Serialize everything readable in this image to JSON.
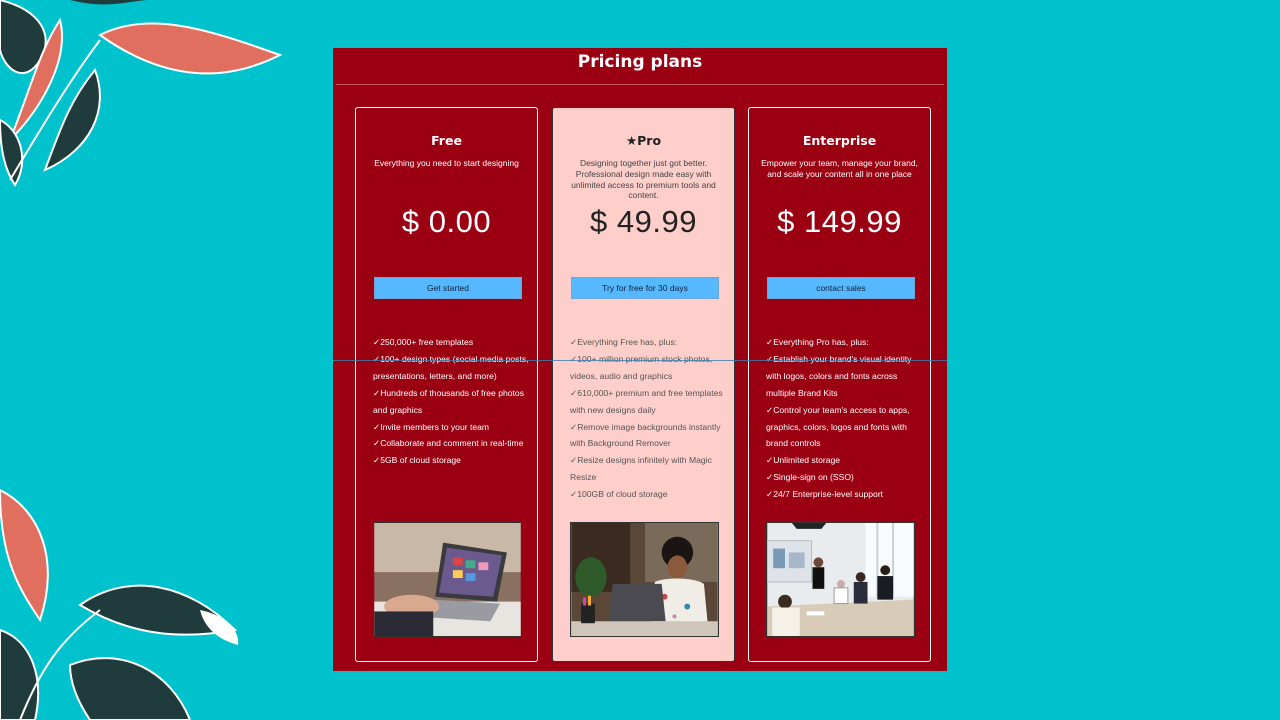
{
  "header": {
    "title": "Pricing plans"
  },
  "plans": [
    {
      "name": "Free",
      "description": "Everything you need to start designing",
      "price": "$ 0.00",
      "cta": "Get started",
      "features": [
        "✓250,000+ free templates",
        "✓100+ design types (social media posts, presentations, letters, and more)",
        "✓Hundreds of thousands of free photos and graphics",
        "✓Invite members to your team",
        "✓Collaborate and comment in real-time",
        "✓5GB of cloud storage"
      ]
    },
    {
      "name": "★Pro",
      "description": "Designing together just got better. Professional design made easy with unlimited access to premium tools and content.",
      "price": "$ 49.99",
      "cta": "Try for free for 30 days",
      "features": [
        "✓Everything Free has, plus:",
        "✓100+ million premium stock photos, videos, audio and graphics",
        "✓610,000+ premium and free templates with new designs daily",
        "✓Remove image backgrounds instantly with Background Remover",
        "✓Resize designs infinitely with Magic Resize",
        "✓100GB of cloud storage"
      ]
    },
    {
      "name": "Enterprise",
      "description": "Empower your team, manage your brand, and scale your content all in one place",
      "price": "$ 149.99",
      "cta": "contact sales",
      "features": [
        "✓Everything Pro has, plus:",
        "✓Establish your brand's visual identity with logos, colors and fonts across multiple Brand Kits",
        "✓Control your team's access to apps, graphics, colors, logos and fonts with brand controls",
        "✓Unlimited storage",
        "✓Single-sign on (SSO)",
        "✓24/7 Enterprise-level support"
      ]
    }
  ],
  "colors": {
    "background": "#00c2cd",
    "panel": "#9b0012",
    "pro_card": "#fecfca",
    "button": "#56b8ff",
    "leaf_coral": "#e06f5f",
    "leaf_dark": "#1f3b3c"
  },
  "images": [
    "laptop-photo",
    "woman-at-laptop-photo",
    "meeting-photo"
  ]
}
